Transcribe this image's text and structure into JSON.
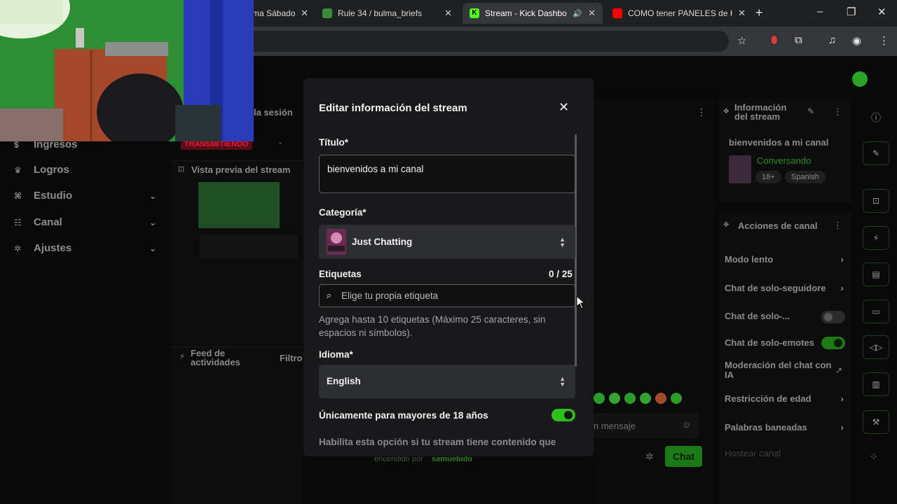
{
  "browser": {
    "tabs": [
      {
        "title": "ma Sábado",
        "favicon_color": "#2b2b2b"
      },
      {
        "title": "Rule 34 / bulma_briefs",
        "favicon_color": "#3c8a3c"
      },
      {
        "title": "Stream - Kick Dashboard",
        "favicon_color": "#53fc18",
        "active": true
      },
      {
        "title": "COMO tener PANELES de KI",
        "favicon_color": "#ff0000"
      }
    ],
    "new_tab_icon": "+",
    "window_controls": [
      "–",
      "❐",
      "✕"
    ]
  },
  "sidebar": {
    "items": [
      {
        "label": "Ingresos",
        "icon": "dollar-icon"
      },
      {
        "label": "Logros",
        "icon": "trophy-icon"
      },
      {
        "label": "Estudio",
        "icon": "studio-icon"
      },
      {
        "label": "Canal",
        "icon": "users-icon"
      },
      {
        "label": "Ajustes",
        "icon": "gear-icon"
      }
    ]
  },
  "session": {
    "header_fragment": "la sesión",
    "status_badge": "TRANSMITIENDO",
    "dash": "-"
  },
  "preview": {
    "title": "Vista previa del stream"
  },
  "feed": {
    "title": "Feed de actividades",
    "filter": "Filtro"
  },
  "chat": {
    "placeholder_fragment": "n mensaje",
    "powered_prefix": "encendido por",
    "powered_user": "samuebido",
    "send_label": "Chat"
  },
  "stream_info": {
    "header": "Información del stream",
    "title": "bienvenidos a mi canal",
    "category": "Conversando",
    "tags": [
      "18+",
      "Spanish"
    ]
  },
  "channel_actions": {
    "header": "Acciones de canal",
    "items": [
      {
        "label": "Modo lento",
        "kind": "chevron"
      },
      {
        "label": "Chat de solo-seguidore",
        "kind": "chevron"
      },
      {
        "label": "Chat de solo-...",
        "kind": "toggle-off"
      },
      {
        "label": "Chat de solo-emotes",
        "kind": "toggle-on"
      },
      {
        "label": "Moderación del chat con IA",
        "kind": "external"
      },
      {
        "label": "Restricción de edad",
        "kind": "chevron"
      },
      {
        "label": "Palabras baneadas",
        "kind": "chevron"
      },
      {
        "label": "Hostear canal",
        "kind": "none"
      }
    ]
  },
  "modal": {
    "title": "Editar información del stream",
    "title_label": "Título*",
    "title_value": "bienvenidos a mi canal",
    "category_label": "Categoría*",
    "category_value": "Just Chatting",
    "tags_label": "Etiquetas",
    "tags_count": "0 / 25",
    "tags_placeholder": "Elige tu propia etiqueta",
    "tags_help": "Agrega hasta 10 etiquetas (Máximo 25 caracteres, sin espacios ni símbolos).",
    "language_label": "Idioma*",
    "language_value": "English",
    "mature_label": "Únicamente para mayores de 18 años",
    "mature_enabled": true,
    "mature_help_cut": "Habilita esta opción si tu stream tiene contenido que"
  },
  "colors": {
    "accent": "#53fc18",
    "toggle_on": "#2fbf1b",
    "live_badge": "#e21c3a"
  }
}
